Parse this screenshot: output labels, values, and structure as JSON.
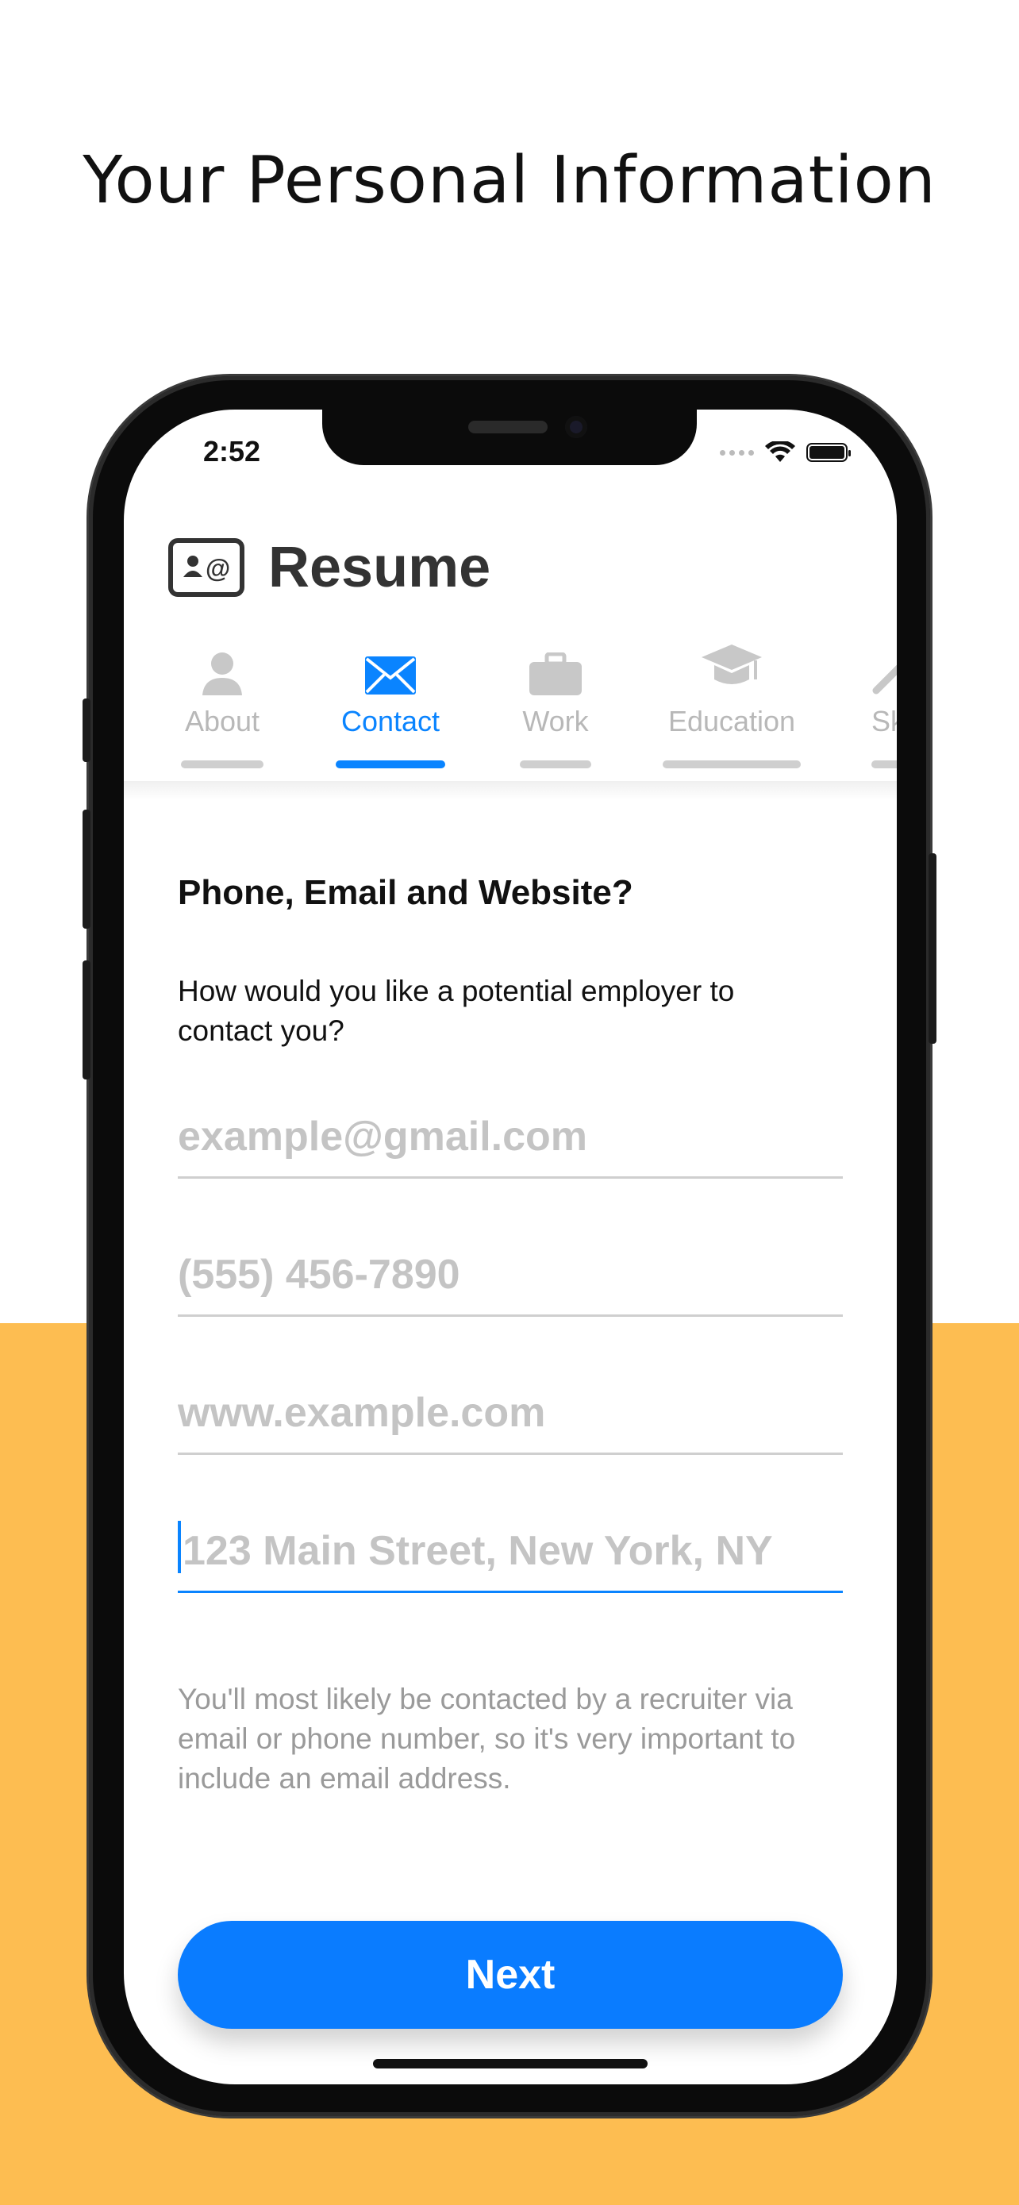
{
  "page": {
    "headline": "Your Personal Information",
    "accent_color": "#0a84ff",
    "background_bottom_color": "#FDBD51"
  },
  "status_bar": {
    "time": "2:52"
  },
  "app": {
    "title": "Resume",
    "icon": "contact-card-icon"
  },
  "tabs": [
    {
      "label": "About",
      "icon": "person-icon",
      "active": false
    },
    {
      "label": "Contact",
      "icon": "envelope-icon",
      "active": true
    },
    {
      "label": "Work",
      "icon": "briefcase-icon",
      "active": false
    },
    {
      "label": "Education",
      "icon": "graduation-cap-icon",
      "active": false
    },
    {
      "label": "Sk",
      "icon": "tools-icon",
      "active": false
    }
  ],
  "form": {
    "title": "Phone, Email and Website?",
    "subtitle": "How would you like a potential employer to contact you?",
    "fields": [
      {
        "placeholder": "example@gmail.com",
        "value": ""
      },
      {
        "placeholder": "(555) 456-7890",
        "value": ""
      },
      {
        "placeholder": "www.example.com",
        "value": ""
      },
      {
        "placeholder": "123 Main Street, New York, NY",
        "value": "",
        "focused": true
      }
    ],
    "hint": "You'll most likely be contacted by a recruiter via email or phone number, so it's very important to include an email address."
  },
  "actions": {
    "next_label": "Next"
  }
}
